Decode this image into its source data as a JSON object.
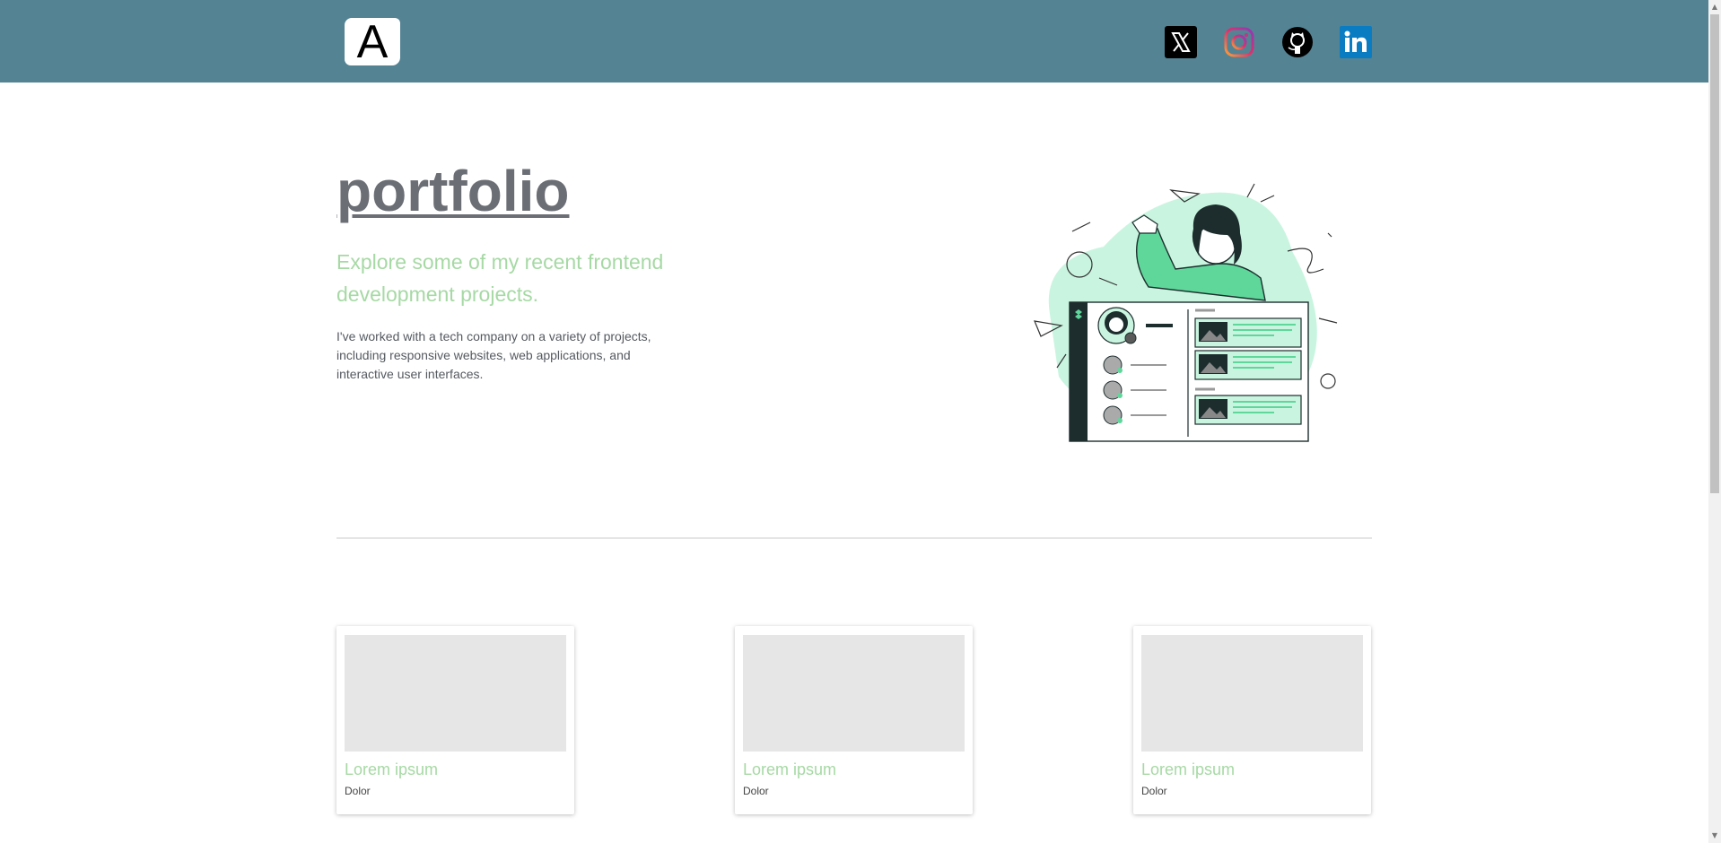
{
  "header": {
    "logo_letter": "A",
    "social": [
      {
        "name": "x-icon",
        "label": "X"
      },
      {
        "name": "instagram-icon",
        "label": "Instagram"
      },
      {
        "name": "github-icon",
        "label": "GitHub"
      },
      {
        "name": "linkedin-icon",
        "label": "LinkedIn"
      }
    ]
  },
  "hero": {
    "title": "portfolio",
    "subtitle": "Explore some of my recent frontend development projects.",
    "description": "I've worked with a tech company on a variety of projects, including responsive websites, web applications, and interactive user interfaces."
  },
  "projects": [
    {
      "title": "Lorem ipsum",
      "subtitle": "Dolor"
    },
    {
      "title": "Lorem ipsum",
      "subtitle": "Dolor"
    },
    {
      "title": "Lorem ipsum",
      "subtitle": "Dolor"
    }
  ],
  "colors": {
    "header_bg": "#548393",
    "accent_green": "#a6d9a4",
    "title_gray": "#6b6e75"
  }
}
